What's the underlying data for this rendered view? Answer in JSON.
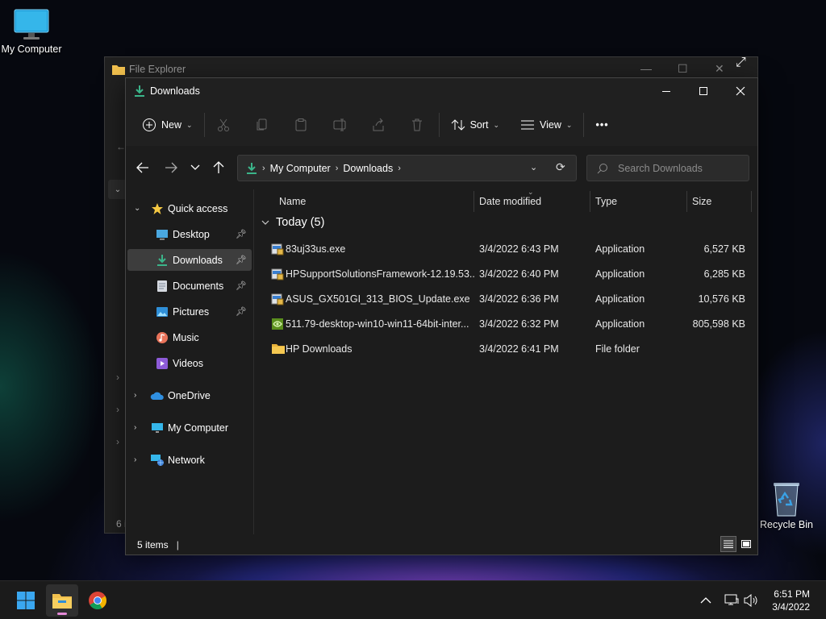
{
  "desktop": {
    "icons": [
      {
        "label": "My Computer"
      },
      {
        "label": "Recycle Bin"
      }
    ]
  },
  "back_window": {
    "title": "File Explorer",
    "status_fragment": "6 i"
  },
  "window": {
    "title": "Downloads",
    "controls": {
      "minimize": "minimize",
      "maximize": "maximize",
      "close": "close"
    }
  },
  "command_bar": {
    "new_label": "New",
    "sort_label": "Sort",
    "view_label": "View",
    "more_label": "•••"
  },
  "address": {
    "crumbs": [
      "My Computer",
      "Downloads"
    ]
  },
  "search": {
    "placeholder": "Search Downloads"
  },
  "sidebar": {
    "items": [
      {
        "label": "Quick access",
        "icon": "star-icon",
        "pinned": false,
        "selected": false
      },
      {
        "label": "Desktop",
        "icon": "desktop-icon",
        "pinned": true,
        "selected": false
      },
      {
        "label": "Downloads",
        "icon": "download-icon",
        "pinned": true,
        "selected": true
      },
      {
        "label": "Documents",
        "icon": "documents-icon",
        "pinned": true,
        "selected": false
      },
      {
        "label": "Pictures",
        "icon": "pictures-icon",
        "pinned": true,
        "selected": false
      },
      {
        "label": "Music",
        "icon": "music-icon",
        "pinned": false,
        "selected": false
      },
      {
        "label": "Videos",
        "icon": "videos-icon",
        "pinned": false,
        "selected": false
      },
      {
        "label": "OneDrive",
        "icon": "cloud-icon",
        "pinned": false,
        "selected": false
      },
      {
        "label": "My Computer",
        "icon": "computer-icon",
        "pinned": false,
        "selected": false
      },
      {
        "label": "Network",
        "icon": "network-icon",
        "pinned": false,
        "selected": false
      }
    ]
  },
  "columns": [
    "Name",
    "Date modified",
    "Type",
    "Size"
  ],
  "group": {
    "label": "Today (5)"
  },
  "files": [
    {
      "name": "83uj33us.exe",
      "date": "3/4/2022 6:43 PM",
      "type": "Application",
      "size": "6,527 KB",
      "icon": "installer-icon"
    },
    {
      "name": "HPSupportSolutionsFramework-12.19.53....",
      "date": "3/4/2022 6:40 PM",
      "type": "Application",
      "size": "6,285 KB",
      "icon": "installer-icon"
    },
    {
      "name": "ASUS_GX501GI_313_BIOS_Update.exe",
      "date": "3/4/2022 6:36 PM",
      "type": "Application",
      "size": "10,576 KB",
      "icon": "installer-icon"
    },
    {
      "name": "511.79-desktop-win10-win11-64bit-inter...",
      "date": "3/4/2022 6:32 PM",
      "type": "Application",
      "size": "805,598 KB",
      "icon": "nvidia-icon"
    },
    {
      "name": "HP Downloads",
      "date": "3/4/2022 6:41 PM",
      "type": "File folder",
      "size": "",
      "icon": "folder-icon"
    }
  ],
  "status": {
    "items_count": "5 items"
  },
  "taskbar": {
    "clock_time": "6:51 PM",
    "clock_date": "3/4/2022"
  },
  "colors": {
    "accent_green": "#3bb58a",
    "folder_yellow": "#f2c14e",
    "selection": "#3d3d3d"
  }
}
